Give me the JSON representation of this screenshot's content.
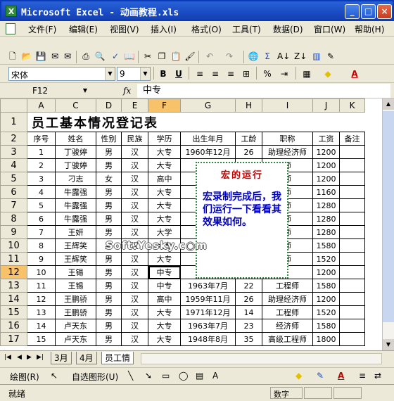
{
  "window": {
    "title": "Microsoft Excel - 动画教程.xls",
    "app_icon": "X"
  },
  "menu": [
    "文件(F)",
    "编辑(E)",
    "视图(V)",
    "插入(I)",
    "格式(O)",
    "工具(T)",
    "数据(D)",
    "窗口(W)",
    "帮助(H)"
  ],
  "format_toolbar": {
    "font": "宋体",
    "size": "9",
    "bold": "B",
    "underline": "U",
    "percent": "%"
  },
  "formula_bar": {
    "cell_ref": "F12",
    "fx": "fx",
    "content": "中专"
  },
  "sheet": {
    "columns": [
      "A",
      "C",
      "D",
      "E",
      "F",
      "G",
      "H",
      "I",
      "J",
      "K"
    ],
    "title": "员工基本情况登记表",
    "headers": [
      "序号",
      "姓名",
      "性别",
      "民族",
      "学历",
      "出生年月",
      "工龄",
      "职称",
      "工资",
      "备注"
    ],
    "rows": [
      {
        "rn": "3",
        "c": [
          "1",
          "丁骏婷",
          "男",
          "汉",
          "大专",
          "1960年12月",
          "26",
          "助理经济师",
          "1200",
          ""
        ]
      },
      {
        "rn": "4",
        "c": [
          "2",
          "丁骏婷",
          "男",
          "汉",
          "大专",
          "195",
          "",
          "师",
          "1200",
          ""
        ]
      },
      {
        "rn": "5",
        "c": [
          "3",
          "刁志",
          "女",
          "汉",
          "高中",
          "196",
          "",
          "师",
          "1200",
          ""
        ]
      },
      {
        "rn": "6",
        "c": [
          "4",
          "牛露强",
          "男",
          "汉",
          "大专",
          "196",
          "",
          "师",
          "1160",
          ""
        ]
      },
      {
        "rn": "7",
        "c": [
          "5",
          "牛露强",
          "男",
          "汉",
          "大专",
          "194",
          "",
          "师",
          "1280",
          ""
        ]
      },
      {
        "rn": "8",
        "c": [
          "6",
          "牛露强",
          "男",
          "汉",
          "大专",
          "194",
          "",
          "师",
          "1280",
          ""
        ]
      },
      {
        "rn": "9",
        "c": [
          "7",
          "王妍",
          "男",
          "汉",
          "大学",
          "197",
          "",
          "师",
          "1280",
          ""
        ]
      },
      {
        "rn": "10",
        "c": [
          "8",
          "王辉笑",
          "男",
          "汉",
          "大专",
          "",
          "",
          "师",
          "1580",
          ""
        ]
      },
      {
        "rn": "11",
        "c": [
          "9",
          "王辉笑",
          "男",
          "汉",
          "大专",
          "194",
          "",
          "师",
          "1520",
          ""
        ]
      },
      {
        "rn": "12",
        "c": [
          "10",
          "王锡",
          "男",
          "汉",
          "中专",
          "195",
          "",
          "",
          "1200",
          ""
        ]
      },
      {
        "rn": "13",
        "c": [
          "11",
          "王锡",
          "男",
          "汉",
          "中专",
          "1963年7月",
          "22",
          "工程师",
          "1580",
          ""
        ]
      },
      {
        "rn": "14",
        "c": [
          "12",
          "王鹏骄",
          "男",
          "汉",
          "高中",
          "1959年11月",
          "26",
          "助理经济师",
          "1200",
          ""
        ]
      },
      {
        "rn": "15",
        "c": [
          "13",
          "王鹏骄",
          "男",
          "汉",
          "大专",
          "1971年12月",
          "14",
          "工程师",
          "1520",
          ""
        ]
      },
      {
        "rn": "16",
        "c": [
          "14",
          "卢天东",
          "男",
          "汉",
          "大专",
          "1963年7月",
          "23",
          "经济师",
          "1580",
          ""
        ]
      },
      {
        "rn": "17",
        "c": [
          "15",
          "卢天东",
          "男",
          "汉",
          "大专",
          "1948年8月",
          "35",
          "高级工程师",
          "1800",
          ""
        ]
      }
    ]
  },
  "note": {
    "heading": "宏的运行",
    "body": "宏录制完成后，我们运行一下看看其效果如何。"
  },
  "watermark": "Soft.Yesky.c◉m",
  "tabs": [
    "3月",
    "4月",
    "员工情"
  ],
  "drawbar": {
    "draw": "绘图(R)",
    "autoshape": "自选图形(U)"
  },
  "status": {
    "ready": "就绪",
    "num": "数字"
  }
}
